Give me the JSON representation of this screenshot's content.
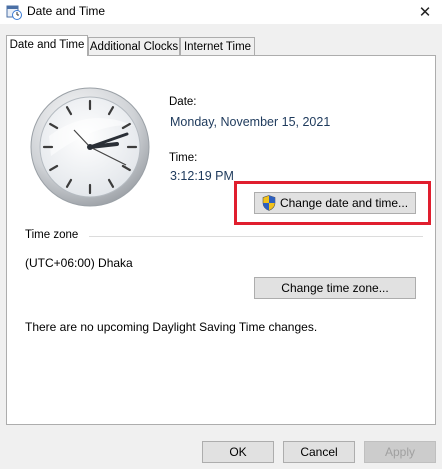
{
  "window": {
    "title": "Date and Time",
    "close_symbol": "✕"
  },
  "tabs": [
    {
      "label": "Date and Time"
    },
    {
      "label": "Additional Clocks"
    },
    {
      "label": "Internet Time"
    }
  ],
  "datetime": {
    "date_label": "Date:",
    "date_value": "Monday, November 15, 2021",
    "time_label": "Time:",
    "time_value": "3:12:19 PM",
    "change_button": "Change date and time..."
  },
  "timezone": {
    "group_label": "Time zone",
    "value": "(UTC+06:00) Dhaka",
    "change_button": "Change time zone...",
    "dst_note": "There are no upcoming Daylight Saving Time changes."
  },
  "footer": {
    "ok": "OK",
    "cancel": "Cancel",
    "apply": "Apply"
  },
  "icons": {
    "title": "calendar-clock-icon",
    "shield": "uac-shield-icon",
    "clock": "analog-clock-icon"
  },
  "colors": {
    "highlight": "#e01e2e",
    "value_text": "#1e3a5c"
  }
}
